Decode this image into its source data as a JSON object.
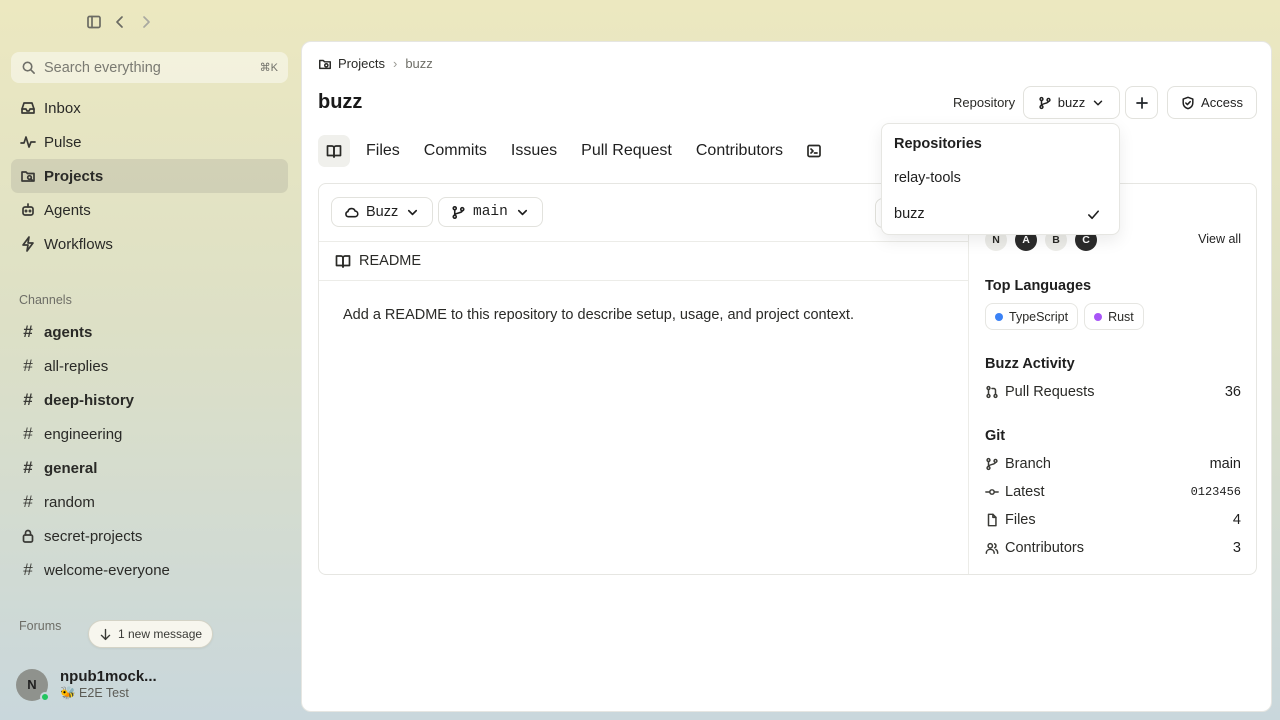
{
  "sidebar": {
    "search": {
      "placeholder": "Search everything",
      "shortcut": "⌘K"
    },
    "nav": [
      {
        "label": "Inbox",
        "icon": "inbox-icon",
        "active": false
      },
      {
        "label": "Pulse",
        "icon": "pulse-icon",
        "active": false
      },
      {
        "label": "Projects",
        "icon": "projects-icon",
        "active": true
      },
      {
        "label": "Agents",
        "icon": "agents-icon",
        "active": false
      },
      {
        "label": "Workflows",
        "icon": "workflows-icon",
        "active": false
      }
    ],
    "channels_label": "Channels",
    "channels": [
      {
        "label": "agents",
        "type": "public",
        "unread": true
      },
      {
        "label": "all-replies",
        "type": "public",
        "unread": false
      },
      {
        "label": "deep-history",
        "type": "public",
        "unread": true
      },
      {
        "label": "engineering",
        "type": "public",
        "unread": false
      },
      {
        "label": "general",
        "type": "public",
        "unread": true
      },
      {
        "label": "random",
        "type": "public",
        "unread": false
      },
      {
        "label": "secret-projects",
        "type": "private",
        "unread": false
      },
      {
        "label": "welcome-everyone",
        "type": "public",
        "unread": false
      }
    ],
    "forums_label": "Forums",
    "new_message": "1 new message",
    "user": {
      "initial": "N",
      "name": "npub1mock...",
      "status": "🐝 E2E Test",
      "online": true
    }
  },
  "main": {
    "breadcrumb": {
      "root": "Projects",
      "current": "buzz"
    },
    "title": "buzz",
    "repository_label": "Repository",
    "repo_selector": "buzz",
    "access_label": "Access",
    "tabs": [
      "Files",
      "Commits",
      "Issues",
      "Pull Request",
      "Contributors"
    ],
    "source_selector": "Buzz",
    "branch_selector": "main",
    "readme_title": "README",
    "readme_text": "Add a README to this repository to describe setup, usage, and project context.",
    "contributors": {
      "avatars": [
        {
          "initial": "N",
          "style": "light"
        },
        {
          "initial": "A",
          "style": "dark"
        },
        {
          "initial": "B",
          "style": "light"
        },
        {
          "initial": "C",
          "style": "dark"
        }
      ],
      "view_all": "View all"
    },
    "top_languages": {
      "title": "Top Languages",
      "items": [
        {
          "name": "TypeScript",
          "color": "#3b82f6"
        },
        {
          "name": "Rust",
          "color": "#a855f7"
        }
      ]
    },
    "activity": {
      "title": "Buzz Activity",
      "pull_requests_label": "Pull Requests",
      "pull_requests_value": "36"
    },
    "git": {
      "title": "Git",
      "branch_label": "Branch",
      "branch_value": "main",
      "latest_label": "Latest",
      "latest_value": "0123456",
      "files_label": "Files",
      "files_value": "4",
      "contributors_label": "Contributors",
      "contributors_value": "3"
    },
    "dropdown": {
      "title": "Repositories",
      "options": [
        {
          "label": "relay-tools",
          "selected": false
        },
        {
          "label": "buzz",
          "selected": true
        }
      ]
    }
  }
}
